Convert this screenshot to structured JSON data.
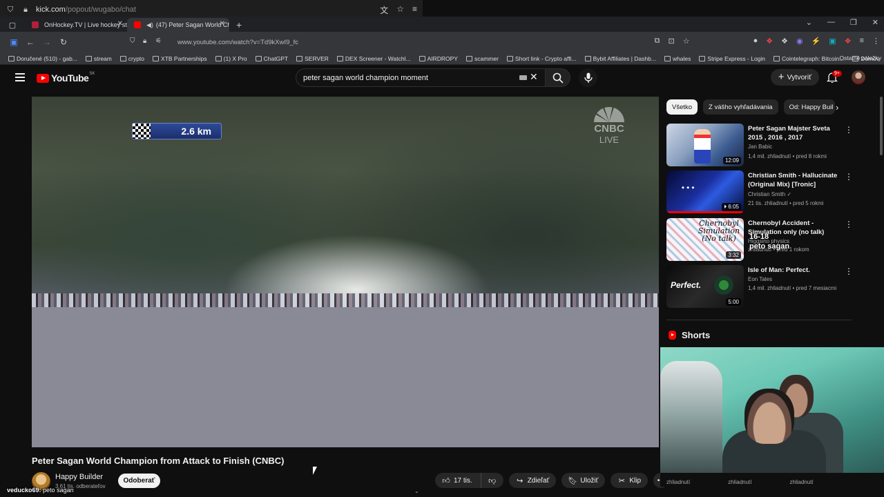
{
  "popout": {
    "url_host": "kick.com",
    "url_path": "/popout/wugabo/chat"
  },
  "tabs": [
    {
      "label": "OnHockey.TV | Live hockey stre",
      "color": "#b0203b"
    },
    {
      "label": "(47) Peter Sagan World Cha",
      "color": "#ff0000"
    }
  ],
  "address": {
    "url": "www.youtube.com/watch?v=Td9kXwI9_fc"
  },
  "bookmarks": [
    "Doručené (510) - gab...",
    "stream",
    "crypto",
    "XTB Partnerships",
    "(1) X Pro",
    "ChatGPT",
    "SERVER",
    "DEX Screener - Watchl...",
    "AIRDROPY",
    "scammer",
    "Short link - Crypto affi...",
    "Bybit Affiliates | Dashb...",
    "whales",
    "Stripe Express - Login",
    "Cointelegraph: Bitcoin...",
    "Domov"
  ],
  "bookmarks_other": "Ostatné záložky",
  "header": {
    "logo_text": "YouTube",
    "region": "SK",
    "search_value": "peter sagan world champion moment",
    "create_label": "Vytvoriť",
    "notif_count": "9+"
  },
  "player": {
    "distance": "2.6 km",
    "broadcaster": "CNBC",
    "broadcaster_sub": "LIVE"
  },
  "video": {
    "title": "Peter Sagan World Champion from Attack to Finish (CNBC)",
    "channel": "Happy Builder",
    "subscribers": "3,61 tis. odberateľov",
    "subscribe_label": "Odoberať",
    "likes": "17 tis.",
    "share_label": "Zdieľať",
    "save_label": "Uložiť",
    "clip_label": "Klip"
  },
  "chat": {
    "user": "veducko69:",
    "message": "peto sagan"
  },
  "chips": [
    "Všetko",
    "Z vášho vyhľadávania",
    "Od: Happy Buil"
  ],
  "recommended": [
    {
      "title": "Peter Sagan  Majster Sveta 2015 , 2016 , 2017",
      "channel": "Jan Babic",
      "meta": "1,4 mil. zhliadnutí • pred 8 rokmi",
      "duration": "12:09"
    },
    {
      "title": "Christian Smith - Hallucinate (Original Mix) [Tronic]",
      "channel": "Christian Smith",
      "meta": "21 tis. zhliadnutí • pred 5 rokmi",
      "duration": "6:05"
    },
    {
      "title": "Chernobyl Accident - Simulation only (no talk)",
      "channel": "Higgsino physics",
      "meta": "zhliadnutí • pred 1 rokom",
      "duration": "3:32",
      "thumb_text": "Chernobyl Simulation (No talk)"
    },
    {
      "title": "Isle of Man: Perfect.",
      "channel": "Eon Tales",
      "meta": "1,4 mil. zhliadnutí • pred 7 mesiacmi",
      "duration": "5:00",
      "thumb_text": "Perfect."
    }
  ],
  "overlay_chat": {
    "line1": "16-18",
    "line2": "peto sagan"
  },
  "shorts": {
    "title": "Shorts",
    "views": [
      "zhliadnutí",
      "zhliadnutí",
      "zhliadnutí"
    ]
  }
}
